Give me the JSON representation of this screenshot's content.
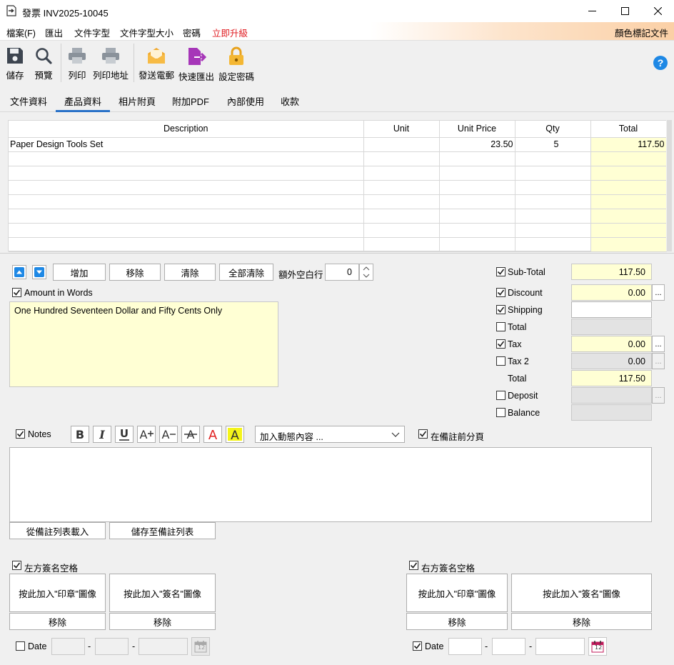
{
  "window": {
    "title": "發票 INV2025-10045"
  },
  "menu": {
    "items": [
      "檔案(F)",
      "匯出",
      "文件字型",
      "文件字型大小",
      "密碼"
    ],
    "upgrade": "立即升級",
    "right": "顏色標記文件"
  },
  "toolbar": {
    "save": "儲存",
    "preview": "預覽",
    "print": "列印",
    "print_address": "列印地址",
    "send_email": "發送電郵",
    "quick_export": "快速匯出",
    "set_password": "設定密碼"
  },
  "tabs": [
    "文件資料",
    "產品資料",
    "相片附頁",
    "附加PDF",
    "內部使用",
    "收款"
  ],
  "grid": {
    "columns": [
      "Description",
      "Unit",
      "Unit Price",
      "Qty",
      "Total"
    ],
    "rows": [
      [
        "Paper Design Tools Set",
        "",
        "23.50",
        "5",
        "117.50"
      ]
    ]
  },
  "actions": {
    "add": "增加",
    "remove": "移除",
    "clear": "清除",
    "clear_all": "全部清除",
    "extra_blank_rows_label": "額外空白行",
    "extra_blank_rows": "0"
  },
  "amount_in_words": {
    "label": "Amount in Words",
    "checked": true,
    "text": "One Hundred Seventeen Dollar and Fifty Cents Only"
  },
  "totals": {
    "subtotal": {
      "label": "Sub-Total",
      "value": "117.50",
      "checked": true
    },
    "discount": {
      "label": "Discount",
      "value": "0.00",
      "checked": true
    },
    "shipping": {
      "label": "Shipping",
      "value": "",
      "checked": true
    },
    "total1": {
      "label": "Total",
      "value": "",
      "checked": false
    },
    "tax": {
      "label": "Tax",
      "value": "0.00",
      "checked": true
    },
    "tax2": {
      "label": "Tax 2",
      "value": "0.00",
      "checked": false
    },
    "total": {
      "label": "Total",
      "value": "117.50"
    },
    "deposit": {
      "label": "Deposit",
      "value": "",
      "checked": false
    },
    "balance": {
      "label": "Balance",
      "value": "",
      "checked": false
    },
    "dots": "..."
  },
  "notes": {
    "label": "Notes",
    "checked": true,
    "dynamic_content_placeholder": "加入動態內容 ...",
    "page_break_label": "在備註前分頁",
    "page_break_checked": true,
    "load_from_list": "從備註列表載入",
    "save_to_list": "儲存至備註列表"
  },
  "signature_left": {
    "label": "左方簽名空格",
    "checked": true,
    "stamp_button": "按此加入\"印章\"圖像",
    "sign_button": "按此加入\"簽名\"圖像",
    "remove": "移除",
    "date_label": "Date",
    "date_checked": false,
    "dash": "-"
  },
  "signature_right": {
    "label": "右方簽名空格",
    "checked": true,
    "stamp_button": "按此加入\"印章\"圖像",
    "sign_button": "按此加入\"簽名\"圖像",
    "remove": "移除",
    "date_label": "Date",
    "date_checked": true,
    "dash": "-"
  },
  "calendar_day": "12",
  "colors": {
    "accent": "#2a72c8",
    "yellow": "#ffffd4",
    "upgrade": "#e0191f"
  }
}
